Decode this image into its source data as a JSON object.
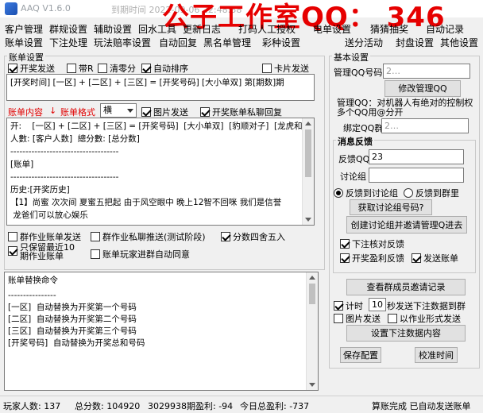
{
  "window": {
    "app_title": "AAQ  V1.6.0",
    "date_text": "到期时间 2022-09-06 22:48:38",
    "watermark": "公子工作室QQ： 346"
  },
  "menu": {
    "row1": [
      "客户管理",
      "群规设置",
      "辅助设置",
      "回水工具",
      "更新日志",
      "打码人工授权",
      "电单设置",
      "猜猜抽奖",
      "自动记录"
    ],
    "row2": [
      "账单设置",
      "下注处理",
      "玩法赔率设置",
      "自动回复",
      "黑名单管理",
      "彩种设置",
      "送分活动",
      "封盘设置",
      "其他设置"
    ]
  },
  "billing": {
    "title": "账单设置",
    "cb_open_send": "开奖发送",
    "cb_with_r": "带R",
    "cb_clear_zero": "清零分",
    "cb_auto_sort": "自动排序",
    "cb_card_send": "卡片发送",
    "format_text": "[开奖时间] [一区] + [二区] + [三区] = [开奖号码] [大小单双] 第[期数]期",
    "content_label": "账单内容",
    "format_label": "账单格式",
    "format_select": "横",
    "cb_image_send": "图片发送",
    "cb_private_reply": "开奖账单私聊回复",
    "content_text": "开:    [一区] + [二区] + [三区] = [开奖号码]  [大小单双]  [豹顺对子]  [龙虎和]\n人數: [客户人数]  總分數: [总分数]\n------------------------------------\n[账单]\n------------------------------------\n历史:[开奖历史]\n【1】尚蜜 次次间 夏蜜五把起 由于风空眼中 晚上12智不回咪 我们是信誉\n 龙爸们可以放心娱乐",
    "cb_group_send": "群作业账单发送",
    "cb_private_chat": "群作业私聊推送(测试阶段)",
    "cb_round": "分数四舍五入",
    "cb_keep_recent": "只保留最近10\n期作业账单",
    "cb_auto_agree": "账单玩家进群自动同意"
  },
  "replace": {
    "title": "账单替换命令",
    "text": "----------------\n[一区]  自动替换为开奖第一个号码\n[二区]  自动替换为开奖第二个号码\n[三区]  自动替换为开奖第三个号码\n[开奖号码]  自动替换为开奖总和号码"
  },
  "basic": {
    "title": "基本设置",
    "admin_label": "管理QQ号码",
    "admin_value": "2…",
    "modify_button": "修改管理QQ",
    "note": "管理QQ：对机器人有绝对的控制权\n多个QQ用@分开",
    "bind_label": "绑定QQ群",
    "bind_value": "2…",
    "feedback_title": "消息反馈",
    "feedback_qq_label": "反馈QQ",
    "feedback_qq_value": "23",
    "discuss_label": "讨论组",
    "discuss_value": "",
    "radio_discuss": "反馈到讨论组",
    "radio_group": "反馈到群里",
    "get_discuss_button": "获取讨论组号码?",
    "create_discuss_button": "创建讨论组并邀请管理Q进去",
    "cb_bet_check": "下注核对反馈",
    "cb_profit_feedback": "开奖盈利反馈",
    "cb_send_bill": "发送账单",
    "view_invite_button": "查看群成员邀请记录",
    "cb_timer": "计时",
    "timer_value": "10",
    "timer_suffix": "秒发送下注数据到群",
    "cb_image_send2": "图片发送",
    "cb_list_send": "以作业形式发送",
    "set_bet_button": "设置下注数据内容",
    "save_button": "保存配置",
    "check_time_button": "校准时间"
  },
  "status": {
    "players": "玩家人数: 137",
    "total_score": "总分数: 104920",
    "period": "3029938期盈利: -94",
    "today": "今日总盈利: -737",
    "done": "算账完成 已自动发送账单"
  }
}
